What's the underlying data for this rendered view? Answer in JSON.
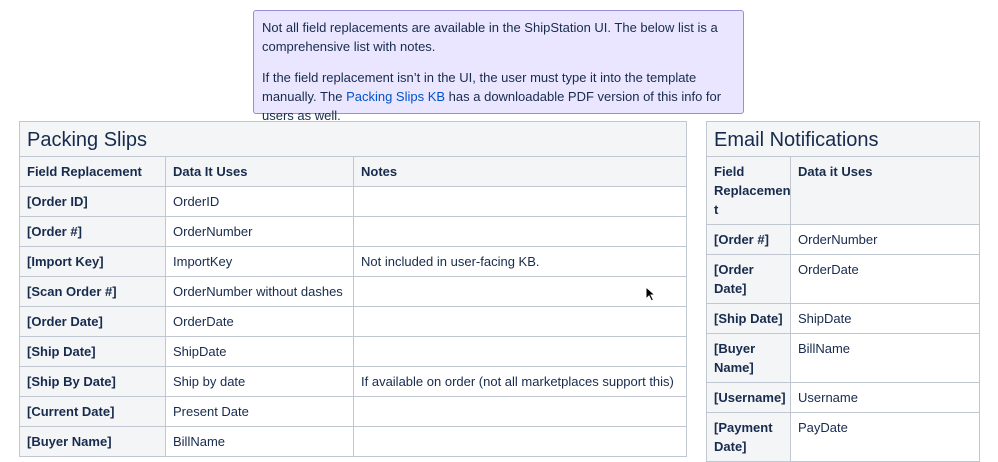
{
  "note": {
    "p1": "Not all field replacements are available in the ShipStation UI. The below list is a comprehensive list with notes.",
    "p2_before": "If the field replacement isn’t in the UI, the user must type it into the template manually. The ",
    "p2_link": "Packing Slips KB",
    "p2_after": " has a downloadable PDF version of this info for users as well."
  },
  "packing": {
    "title": "Packing Slips",
    "headers": [
      "Field Replacement",
      "Data It Uses",
      "Notes"
    ],
    "rows": [
      [
        "[Order ID]",
        "OrderID",
        ""
      ],
      [
        "[Order #]",
        "OrderNumber",
        ""
      ],
      [
        "[Import Key]",
        "ImportKey",
        "Not included in user-facing KB."
      ],
      [
        "[Scan Order #]",
        "OrderNumber without dashes",
        ""
      ],
      [
        "[Order Date]",
        "OrderDate",
        ""
      ],
      [
        "[Ship Date]",
        "ShipDate",
        ""
      ],
      [
        "[Ship By Date]",
        "Ship by date",
        "If available on order (not all marketplaces support this)"
      ],
      [
        "[Current Date]",
        "Present Date",
        ""
      ],
      [
        "[Buyer Name]",
        "BillName",
        ""
      ]
    ]
  },
  "email": {
    "title": "Email Notifications",
    "headers": [
      "Field Replacemen t",
      "Data it Uses"
    ],
    "rows": [
      [
        "[Order #]",
        "OrderNumber"
      ],
      [
        "[Order Date]",
        "OrderDate"
      ],
      [
        "[Ship Date]",
        "ShipDate"
      ],
      [
        "[Buyer Name]",
        "BillName"
      ],
      [
        "[Username]",
        "Username"
      ],
      [
        "[Payment Date]",
        "PayDate"
      ]
    ]
  }
}
